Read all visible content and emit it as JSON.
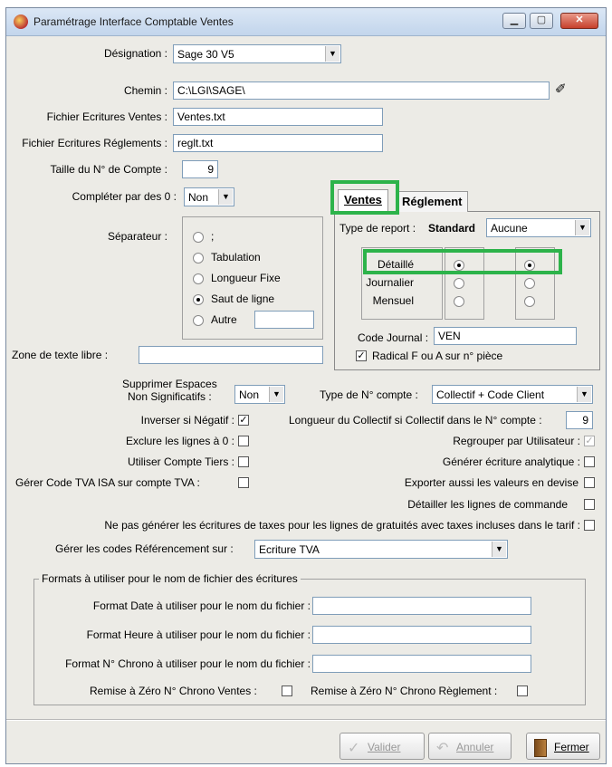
{
  "window": {
    "title": "Paramétrage Interface Comptable Ventes"
  },
  "designation": {
    "label": "Désignation :",
    "value": "Sage 30 V5"
  },
  "chemin": {
    "label": "Chemin :",
    "value": "C:\\LGI\\SAGE\\"
  },
  "fichier_ventes": {
    "label": "Fichier Ecritures Ventes :",
    "value": "Ventes.txt"
  },
  "fichier_reglements": {
    "label": "Fichier Ecritures Réglements :",
    "value": "reglt.txt"
  },
  "taille_compte": {
    "label": "Taille du N° de Compte :",
    "value": "9"
  },
  "completer": {
    "label": "Compléter par des 0 :",
    "value": "Non"
  },
  "separateur": {
    "label": "Séparateur :",
    "options": [
      ";",
      "Tabulation",
      "Longueur Fixe",
      "Saut de ligne",
      "Autre"
    ],
    "selected": "Saut de ligne",
    "autre_value": ""
  },
  "zone_texte": {
    "label": "Zone de texte libre :",
    "value": ""
  },
  "tabs": {
    "ventes": "Ventes",
    "reglement": "Réglement"
  },
  "report": {
    "label": "Type de report :",
    "standard": "Standard",
    "value": "Aucune",
    "rows": [
      "Détaillé",
      "Journalier",
      "Mensuel"
    ],
    "col1_selected": "Détaillé",
    "col2_selected": "Détaillé"
  },
  "code_journal": {
    "label": "Code Journal :",
    "value": "VEN"
  },
  "radical": {
    "label": "Radical F ou A sur n° pièce",
    "checked": true
  },
  "supprimer_espaces": {
    "label_line1": "Supprimer Espaces",
    "label_line2": "Non Significatifs :",
    "value": "Non"
  },
  "type_compte": {
    "label": "Type de N° compte :",
    "value": "Collectif + Code Client"
  },
  "longueur_collectif": {
    "label": "Longueur du Collectif si Collectif dans le N° compte :",
    "value": "9"
  },
  "inverser": {
    "label": "Inverser si Négatif :",
    "checked": true
  },
  "regrouper": {
    "label": "Regrouper par Utilisateur :",
    "checked": true,
    "disabled": true
  },
  "exclure": {
    "label": "Exclure les lignes à 0 :",
    "checked": false
  },
  "generer_analytique": {
    "label": "Générer écriture analytique :",
    "checked": false
  },
  "compte_tiers": {
    "label": "Utiliser Compte Tiers :",
    "checked": false
  },
  "tva_isa": {
    "label": "Gérer Code TVA ISA sur compte TVA :",
    "checked": false
  },
  "exporter_devise": {
    "label": "Exporter aussi les valeurs en devise",
    "checked": false
  },
  "detailler": {
    "label": "Détailler les lignes de commande",
    "checked": false
  },
  "ne_pas_generer": {
    "label": "Ne pas générer les écritures de taxes pour les lignes de gratuités avec taxes incluses dans le tarif :",
    "checked": false
  },
  "referencement": {
    "label": "Gérer les codes Référencement sur :",
    "value": "Ecriture TVA"
  },
  "formats": {
    "legend": "Formats à utiliser pour le nom de fichier des écritures",
    "date_label": "Format Date à utiliser pour le nom du fichier :",
    "heure_label": "Format Heure à utiliser pour le nom du fichier :",
    "chrono_label": "Format N° Chrono à utiliser pour le nom du fichier :",
    "remise_ventes": "Remise à Zéro N° Chrono  Ventes :",
    "remise_reglement": "Remise à Zéro N° Chrono Règlement :"
  },
  "buttons": {
    "valider": "Valider",
    "annuler": "Annuler",
    "fermer": "Fermer"
  }
}
